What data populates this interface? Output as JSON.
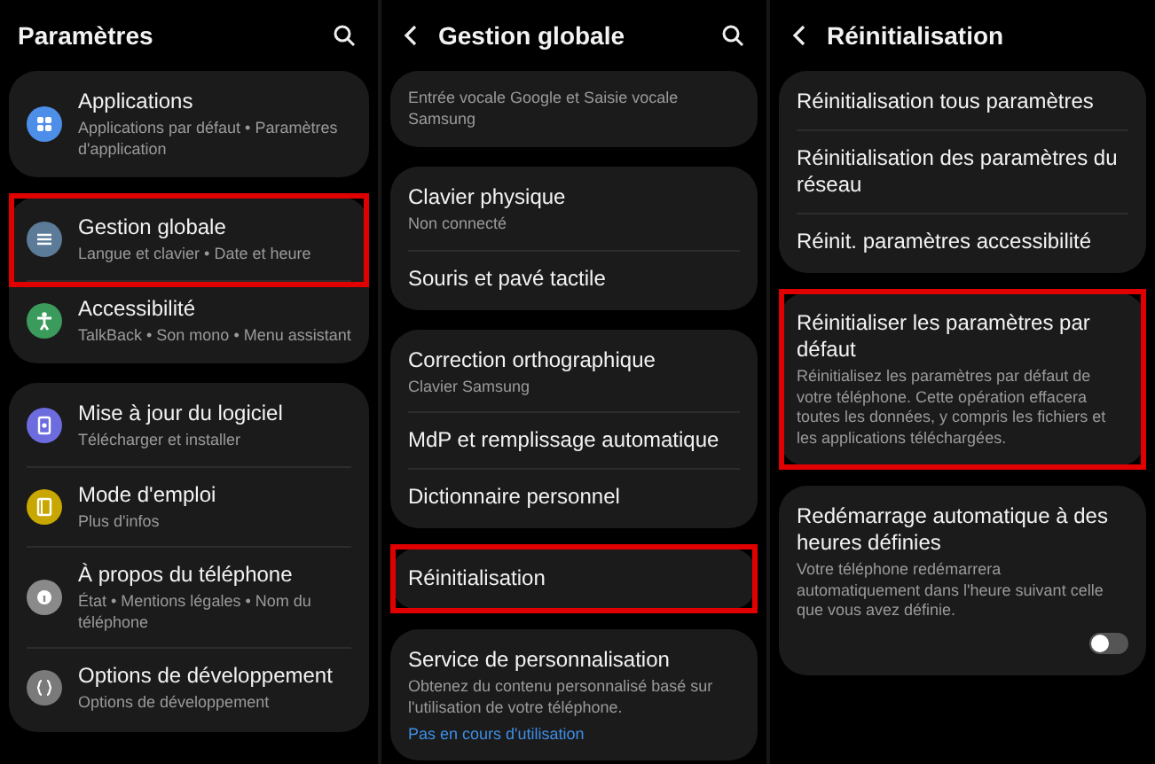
{
  "panels": [
    {
      "title": "Paramètres",
      "back": false,
      "search": true,
      "groups": [
        {
          "items": [
            {
              "title": "Applications",
              "subtitle": "Applications par défaut  •  Paramètres d'application",
              "kind": "apps",
              "color": "#4d8fe8",
              "highlighted": false
            }
          ]
        },
        {
          "items": [
            {
              "title": "Gestion globale",
              "subtitle": "Langue et clavier  •  Date et heure",
              "kind": "sliders",
              "color": "#5b7b98",
              "highlighted": true
            },
            {
              "title": "Accessibilité",
              "subtitle": "TalkBack  •  Son mono  •  Menu assistant",
              "kind": "person",
              "color": "#3b9b5c",
              "highlighted": false
            }
          ]
        },
        {
          "items": [
            {
              "title": "Mise à jour du logiciel",
              "subtitle": "Télécharger et installer",
              "kind": "update",
              "color": "#6c6cdf",
              "highlighted": false
            },
            {
              "title": "Mode d'emploi",
              "subtitle": "Plus d'infos",
              "kind": "book",
              "color": "#c8a800",
              "highlighted": false
            },
            {
              "title": "À propos du téléphone",
              "subtitle": "État  •  Mentions légales  •  Nom du téléphone",
              "kind": "info",
              "color": "#8a8a8a",
              "highlighted": false
            },
            {
              "title": "Options de développement",
              "subtitle": "Options de développement",
              "kind": "braces",
              "color": "#7a7a7a",
              "highlighted": false
            }
          ]
        }
      ]
    },
    {
      "title": "Gestion globale",
      "back": true,
      "search": true,
      "groups": [
        {
          "items": [
            {
              "subtitle": "Entrée vocale Google et Saisie vocale Samsung",
              "highlighted": false
            }
          ]
        },
        {
          "items": [
            {
              "title": "Clavier physique",
              "subtitle": "Non connecté",
              "highlighted": false
            },
            {
              "title": "Souris et pavé tactile",
              "highlighted": false
            }
          ]
        },
        {
          "items": [
            {
              "title": "Correction orthographique",
              "subtitle": "Clavier Samsung",
              "highlighted": false
            },
            {
              "title": "MdP et remplissage automatique",
              "highlighted": false
            },
            {
              "title": "Dictionnaire personnel",
              "highlighted": false
            }
          ]
        },
        {
          "items": [
            {
              "title": "Réinitialisation",
              "highlighted": true
            }
          ]
        },
        {
          "items": [
            {
              "title": "Service de personnalisation",
              "subtitle": "Obtenez du contenu personnalisé basé sur l'utilisation de votre téléphone.",
              "link": "Pas en cours d'utilisation",
              "highlighted": false
            }
          ]
        }
      ]
    },
    {
      "title": "Réinitialisation",
      "back": true,
      "search": false,
      "groups": [
        {
          "items": [
            {
              "title": "Réinitialisation tous paramètres",
              "highlighted": false
            },
            {
              "title": "Réinitialisation des paramètres du réseau",
              "highlighted": false
            },
            {
              "title": "Réinit. paramètres accessibilité",
              "highlighted": false
            }
          ]
        },
        {
          "items": [
            {
              "title": "Réinitialiser les paramètres par défaut",
              "subtitle": "Réinitialisez les paramètres par défaut de votre téléphone. Cette opération effacera toutes les données, y compris les fichiers et les applications téléchargées.",
              "highlighted": true
            }
          ]
        },
        {
          "items": [
            {
              "title": "Redémarrage automatique à des heures définies",
              "subtitle": "Votre téléphone redémarrera automatiquement dans l'heure suivant celle que vous avez définie.",
              "toggle": {
                "on": false
              },
              "highlighted": false
            }
          ]
        }
      ]
    }
  ]
}
